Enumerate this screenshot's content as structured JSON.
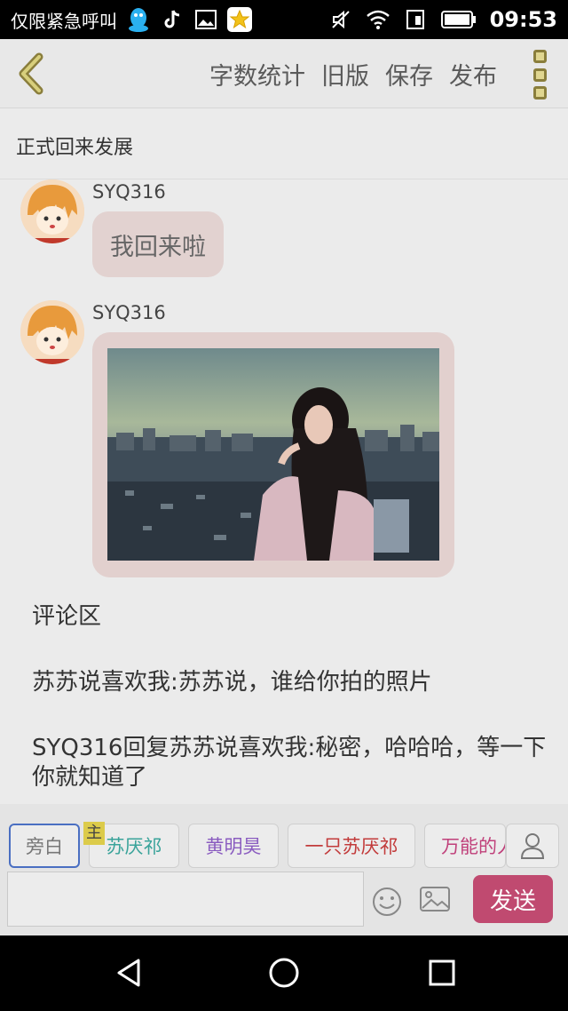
{
  "status_bar": {
    "notification_text": "仅限紧急呼叫",
    "time": "09:53",
    "icons": [
      "qq-icon",
      "tiktok-icon",
      "gallery-icon",
      "star-app-icon",
      "mute-icon",
      "wifi-icon",
      "sim-icon",
      "battery-icon"
    ]
  },
  "toolbar": {
    "back_icon": "chevron-left-icon",
    "actions": [
      "字数统计",
      "旧版",
      "保存",
      "发布"
    ],
    "more_icon": "more-vertical-icon"
  },
  "doc": {
    "title": "正式回来发展"
  },
  "messages": [
    {
      "user": "SYQ316",
      "text": "我回来啦"
    },
    {
      "user": "SYQ316",
      "type": "image"
    }
  ],
  "comments": {
    "heading": "评论区",
    "items": [
      "苏苏说喜欢我:苏苏说，谁给你拍的照片",
      "SYQ316回复苏苏说喜欢我:秘密，哈哈哈，等一下你就知道了"
    ]
  },
  "roles": [
    {
      "label": "旁白",
      "color": "#777777"
    },
    {
      "label": "苏厌祁",
      "color": "#3aa39a"
    },
    {
      "label": "黄明昊",
      "color": "#8a5cc0"
    },
    {
      "label": "一只苏厌祁",
      "color": "#c23b3b"
    },
    {
      "label": "万能的人",
      "color": "#c0407a"
    }
  ],
  "main_badge": "主",
  "input": {
    "placeholder": ""
  },
  "send_label": "发送",
  "colors": {
    "accent": "#c04a70",
    "active_role_border": "#4a6fc2"
  }
}
